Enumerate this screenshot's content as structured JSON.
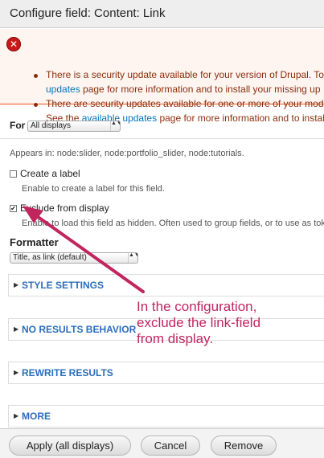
{
  "dialog": {
    "title": "Configure field: Content: Link"
  },
  "messages": {
    "items": [
      {
        "line1": "There is a security update available for your version of Drupal. To e",
        "line2_link": "updates",
        "line2_rest": " page for more information and to install your missing up"
      },
      {
        "line1": "There are security updates available for one or more of your modu",
        "line2_pre": "See the ",
        "line2_link": "available updates",
        "line2_rest": " page for more information and to instal"
      }
    ]
  },
  "for": {
    "label": "For",
    "value": "All displays"
  },
  "appears_in": "Appears in: node:slider, node:portfolio_slider, node:tutorials.",
  "create_label": {
    "label": "Create a label",
    "description": "Enable to create a label for this field.",
    "checked": false
  },
  "exclude": {
    "label": "Exclude from display",
    "description": "Enable to load this field as hidden. Often used to group fields, or to use as token i",
    "checked": true,
    "check_glyph": "✔"
  },
  "formatter": {
    "label": "Formatter",
    "value": "Title, as link (default)"
  },
  "fieldsets": [
    {
      "label": "STYLE SETTINGS"
    },
    {
      "label": "NO RESULTS BEHAVIOR"
    },
    {
      "label": "REWRITE RESULTS"
    },
    {
      "label": "MORE"
    }
  ],
  "annotation": {
    "lines": [
      "In the configuration,",
      "exclude the link-field",
      "from display."
    ],
    "color": "#c0265d"
  },
  "buttons": {
    "apply": "Apply (all displays)",
    "cancel": "Cancel",
    "remove": "Remove"
  },
  "glyphs": {
    "error": "✕",
    "triangle": "▶",
    "select_arrows": "▲▼"
  }
}
